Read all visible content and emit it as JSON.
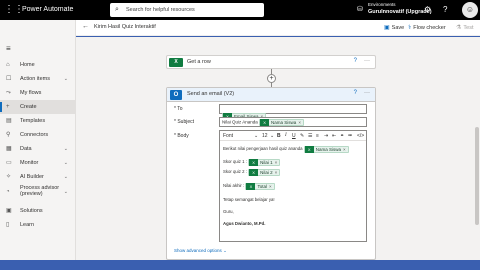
{
  "topbar": {
    "app_title": "Power Automate",
    "search_placeholder": "Search for helpful resources",
    "env_label": "Environments",
    "env_name": "GuruInnovatif (Upgrade)",
    "icons": [
      "waffle-icon",
      "search-icon",
      "environment-icon",
      "gear-icon",
      "help-icon",
      "avatar"
    ]
  },
  "sidebar": {
    "items": [
      {
        "label": "Home",
        "icon": "home-icon",
        "chevron": false
      },
      {
        "label": "Action items",
        "icon": "action-items-icon",
        "chevron": true
      },
      {
        "label": "My flows",
        "icon": "flows-icon",
        "chevron": false
      },
      {
        "label": "Create",
        "icon": "plus-icon",
        "chevron": false,
        "active": true
      },
      {
        "label": "Templates",
        "icon": "templates-icon",
        "chevron": false
      },
      {
        "label": "Connectors",
        "icon": "connectors-icon",
        "chevron": false
      },
      {
        "label": "Data",
        "icon": "data-icon",
        "chevron": true
      },
      {
        "label": "Monitor",
        "icon": "monitor-icon",
        "chevron": true
      },
      {
        "label": "AI Builder",
        "icon": "ai-builder-icon",
        "chevron": true
      },
      {
        "label": "Process advisor (preview)",
        "icon": "process-advisor-icon",
        "chevron": true
      },
      {
        "label": "Solutions",
        "icon": "solutions-icon",
        "chevron": false
      },
      {
        "label": "Learn",
        "icon": "learn-icon",
        "chevron": false
      }
    ]
  },
  "commandbar": {
    "flow_title": "Kirim Hasil Quiz Interaktif",
    "save": "Save",
    "flow_checker": "Flow checker",
    "test": "Test"
  },
  "steps": {
    "get_row": {
      "label": "Get a row",
      "icon": "excel-icon"
    },
    "send_email": {
      "label": "Send an email (V2)",
      "icon": "outlook-icon",
      "to_label": "* To",
      "to_token": "Email Siswa",
      "subject_label": "* Subject",
      "subject_text": "Nilai Quiz Ananda",
      "subject_token": "Nama Siswa",
      "body_label": "* Body",
      "font": "Font",
      "font_size": "12",
      "body": {
        "line1_text": "Berikut nilai pengerjaan hasil quiz ananda",
        "line1_token": "Nama Siswa",
        "skor1_text": "Skor quiz 1 :",
        "skor1_token": "Nilai 1",
        "skor2_text": "Skor quiz 2 :",
        "skor2_token": "Nilai 2",
        "akhir_text": "Nilai akhir :",
        "akhir_token": "Total",
        "semangat": "Tetap semangat belajar ya!",
        "guru": "Guru,",
        "signature": "Agus Dwianto, M.Pd."
      },
      "show_advanced": "Show advanced options"
    }
  },
  "colors": {
    "accent": "#0f6cbd",
    "excel": "#107c41",
    "background": "#3a5fb0"
  }
}
